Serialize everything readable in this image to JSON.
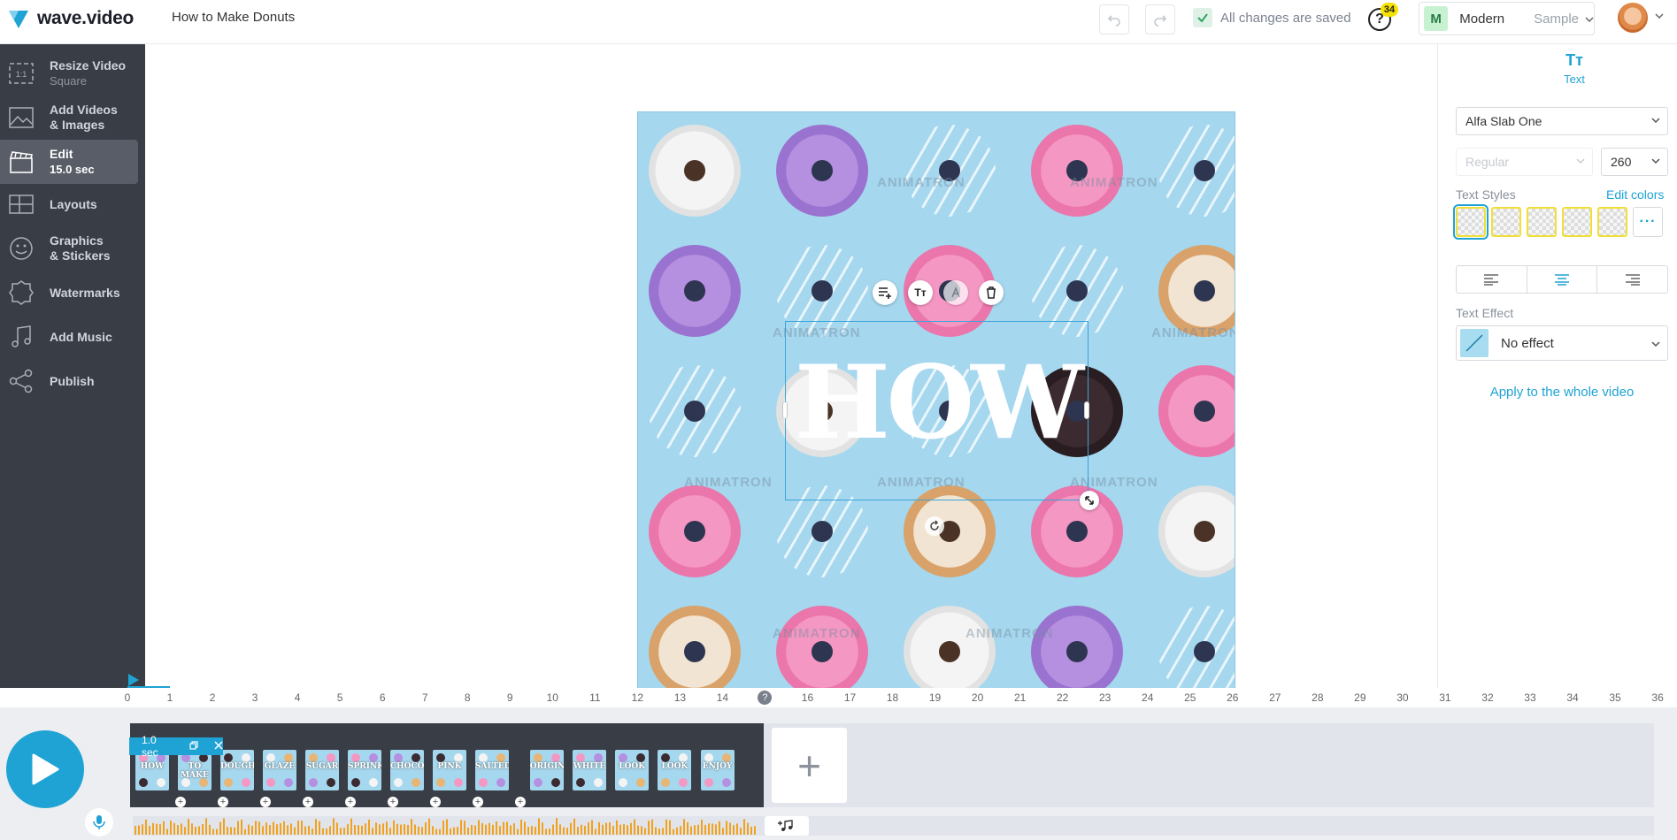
{
  "app": {
    "logo_text": "wave.video",
    "document_title": "How to Make Donuts",
    "save_status": "All changes are saved",
    "help_badge": "34",
    "style": {
      "badge": "M",
      "name": "Modern",
      "sample": "Sample"
    },
    "brand_color": "#1fa3d4"
  },
  "sidebar": {
    "items": [
      {
        "label": "Resize Video",
        "sub": "Square",
        "icon": "resize-icon",
        "detail": "1:1"
      },
      {
        "label": "Add Videos",
        "label2": "& Images",
        "icon": "image-icon"
      },
      {
        "label": "Edit",
        "sub": "15.0 sec",
        "icon": "clapperboard-icon",
        "active": true
      },
      {
        "label": "Layouts",
        "icon": "layouts-icon"
      },
      {
        "label": "Graphics",
        "label2": "& Stickers",
        "icon": "sticker-icon"
      },
      {
        "label": "Watermarks",
        "icon": "watermark-icon"
      },
      {
        "label": "Add Music",
        "icon": "music-icon"
      },
      {
        "label": "Publish",
        "icon": "share-icon"
      }
    ]
  },
  "canvas": {
    "text": "HOW",
    "watermark": "ANIMATRON",
    "toolbar": [
      {
        "name": "add-line-icon",
        "glyph": "≡+"
      },
      {
        "name": "text-size-icon",
        "glyph": "Tт"
      },
      {
        "name": "text-color-icon",
        "glyph": "A"
      },
      {
        "name": "delete-icon",
        "glyph": "🗑"
      }
    ]
  },
  "right_panel": {
    "tab_label": "Text",
    "tab_glyph": "Tт",
    "font": "Alfa Slab One",
    "weight_placeholder": "Regular",
    "size": "260",
    "text_styles_label": "Text Styles",
    "edit_colors": "Edit colors",
    "more_glyph": "···",
    "text_effect_label": "Text Effect",
    "text_effect": "No effect",
    "apply_link": "Apply to the whole video"
  },
  "timeline": {
    "ruler": [
      "0",
      "1",
      "2",
      "3",
      "4",
      "5",
      "6",
      "7",
      "8",
      "9",
      "10",
      "11",
      "12",
      "13",
      "14",
      "15",
      "16",
      "17",
      "18",
      "19",
      "20",
      "21",
      "22",
      "23",
      "24",
      "25",
      "26",
      "27",
      "28",
      "29",
      "30",
      "31",
      "32",
      "33",
      "34",
      "35",
      "36"
    ],
    "playhead_label": "?",
    "clip_duration": "1.0 sec",
    "clips": [
      {
        "label": "HOW"
      },
      {
        "label": "TO MAKE"
      },
      {
        "label": "DOUGHNUTS"
      },
      {
        "label": "GLAZE"
      },
      {
        "label": "SUGAR"
      },
      {
        "label": "SPRINKLED"
      },
      {
        "label": "CHOCOLATE"
      },
      {
        "label": "PINK"
      },
      {
        "label": "SALTED"
      },
      {
        "label": "ORIGINAL"
      },
      {
        "label": "WHITE"
      },
      {
        "label": "LOOK"
      },
      {
        "label": "LOOK"
      },
      {
        "label": "ENJOY"
      }
    ],
    "add_clip": "+"
  }
}
